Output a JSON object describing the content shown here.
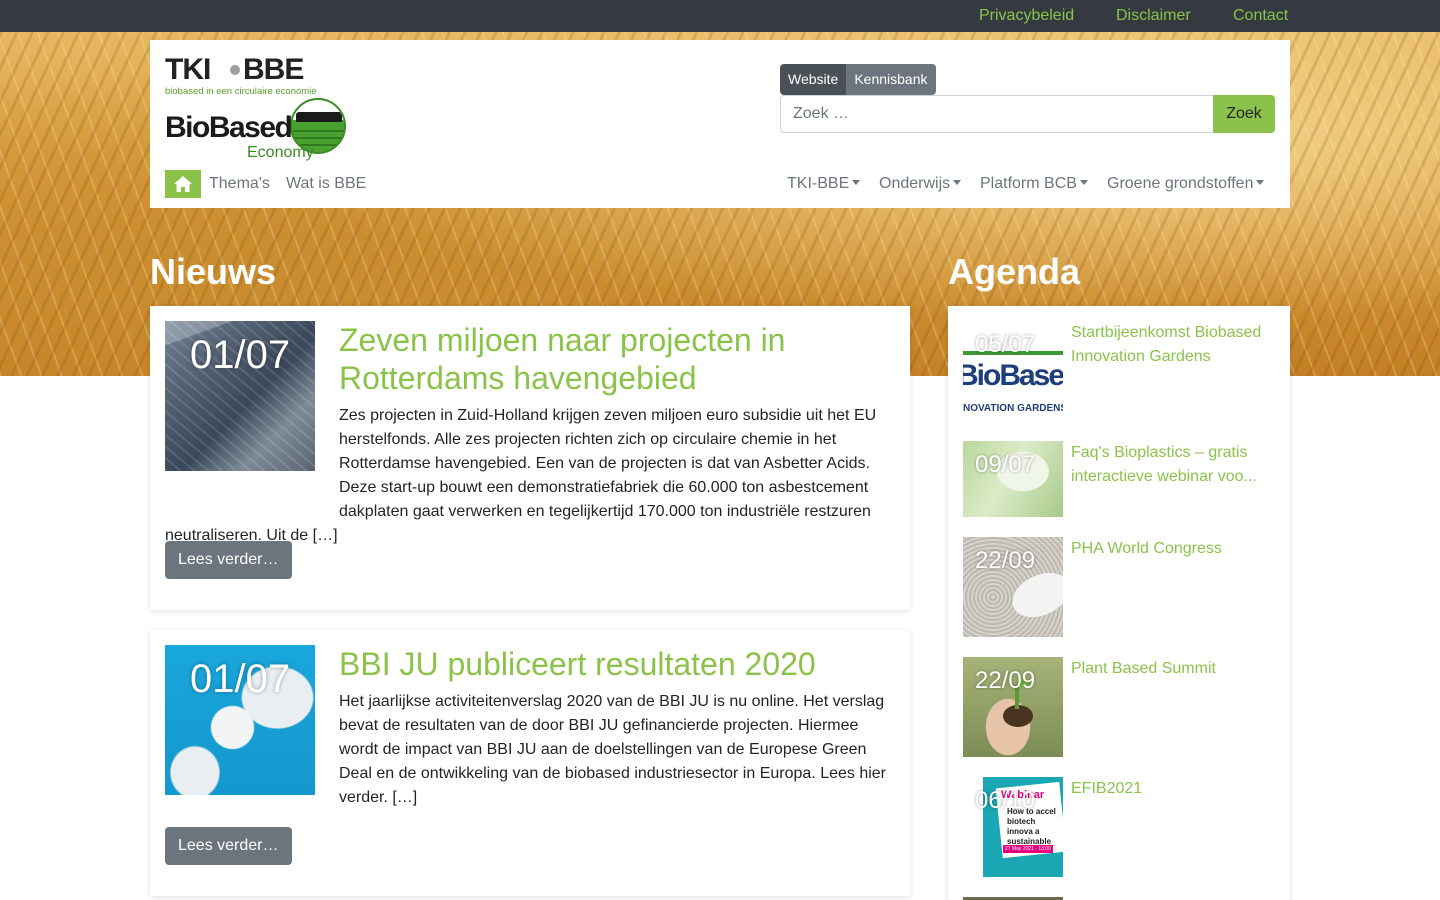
{
  "topbar": {
    "links": [
      "Privacybeleid",
      "Disclaimer",
      "Contact"
    ]
  },
  "logo": {
    "tki": "TKI",
    "bbe": "BBE",
    "tagline": "biobased in een circulaire economie",
    "brand": "BioBased",
    "brand_sub": "Economy"
  },
  "search": {
    "toggle_website": "Website",
    "toggle_kennisbank": "Kennisbank",
    "placeholder": "Zoek …",
    "button": "Zoek"
  },
  "nav": {
    "left": [
      "Thema's",
      "Wat is BBE"
    ],
    "right": [
      "TKI-BBE",
      "Onderwijs",
      "Platform BCB",
      "Groene grondstoffen"
    ]
  },
  "news": {
    "heading": "Nieuws",
    "read_more": "Lees verder…",
    "items": [
      {
        "date": "01/07",
        "title": "Zeven miljoen naar projecten in Rotterdams havengebied",
        "body": "Zes projecten in Zuid-Holland krijgen zeven miljoen euro subsidie uit het EU herstelfonds. Alle zes projecten richten zich op circulaire chemie in het Rotterdamse havengebied. Een van de projecten is dat van Asbetter Acids. Deze start-up bouwt een demonstratiefabriek die 60.000 ton asbestcement dakplaten gaat verwerken en tegelijkertijd 170.000 ton industriële restzuren neutraliseren. Uit de […]"
      },
      {
        "date": "01/07",
        "title": "BBI JU publiceert resultaten 2020",
        "body": "Het jaarlijkse  activiteitenverslag 2020 van  de  BBI JU is  nu  online. Het verslag  bevat  de  resultaten  van  de door BBI JU gefinancierde projecten. Hiermee wordt de impact van  BBI JU aan de  doelstellingen  van  de Europese Green Deal en de ontwikkeling van de biobased industriesector in Europa.   Lees hier verder. […]"
      }
    ]
  },
  "agenda": {
    "heading": "Agenda",
    "items": [
      {
        "date": "05/07",
        "title": "Startbijeenkomst Biobased Innovation Gardens",
        "thumb_text": "BioBased",
        "thumb_sub": "NOVATION GARDENS"
      },
      {
        "date": "09/07",
        "title": "Faq's Bioplastics – gratis interactieve webinar voo..."
      },
      {
        "date": "22/09",
        "title": "PHA World Congress"
      },
      {
        "date": "22/09",
        "title": "Plant Based Summit"
      },
      {
        "date": "06/10",
        "title": "EFIB2021",
        "thumb_text": "Webinar",
        "thumb_sub": "How to accel biotech innova a sustainable",
        "thumb_date": "27 May 2021 - 13:00"
      }
    ]
  },
  "colors": {
    "accent": "#8bc34a",
    "topbar": "#343a40",
    "button_grey": "#6c757d"
  }
}
